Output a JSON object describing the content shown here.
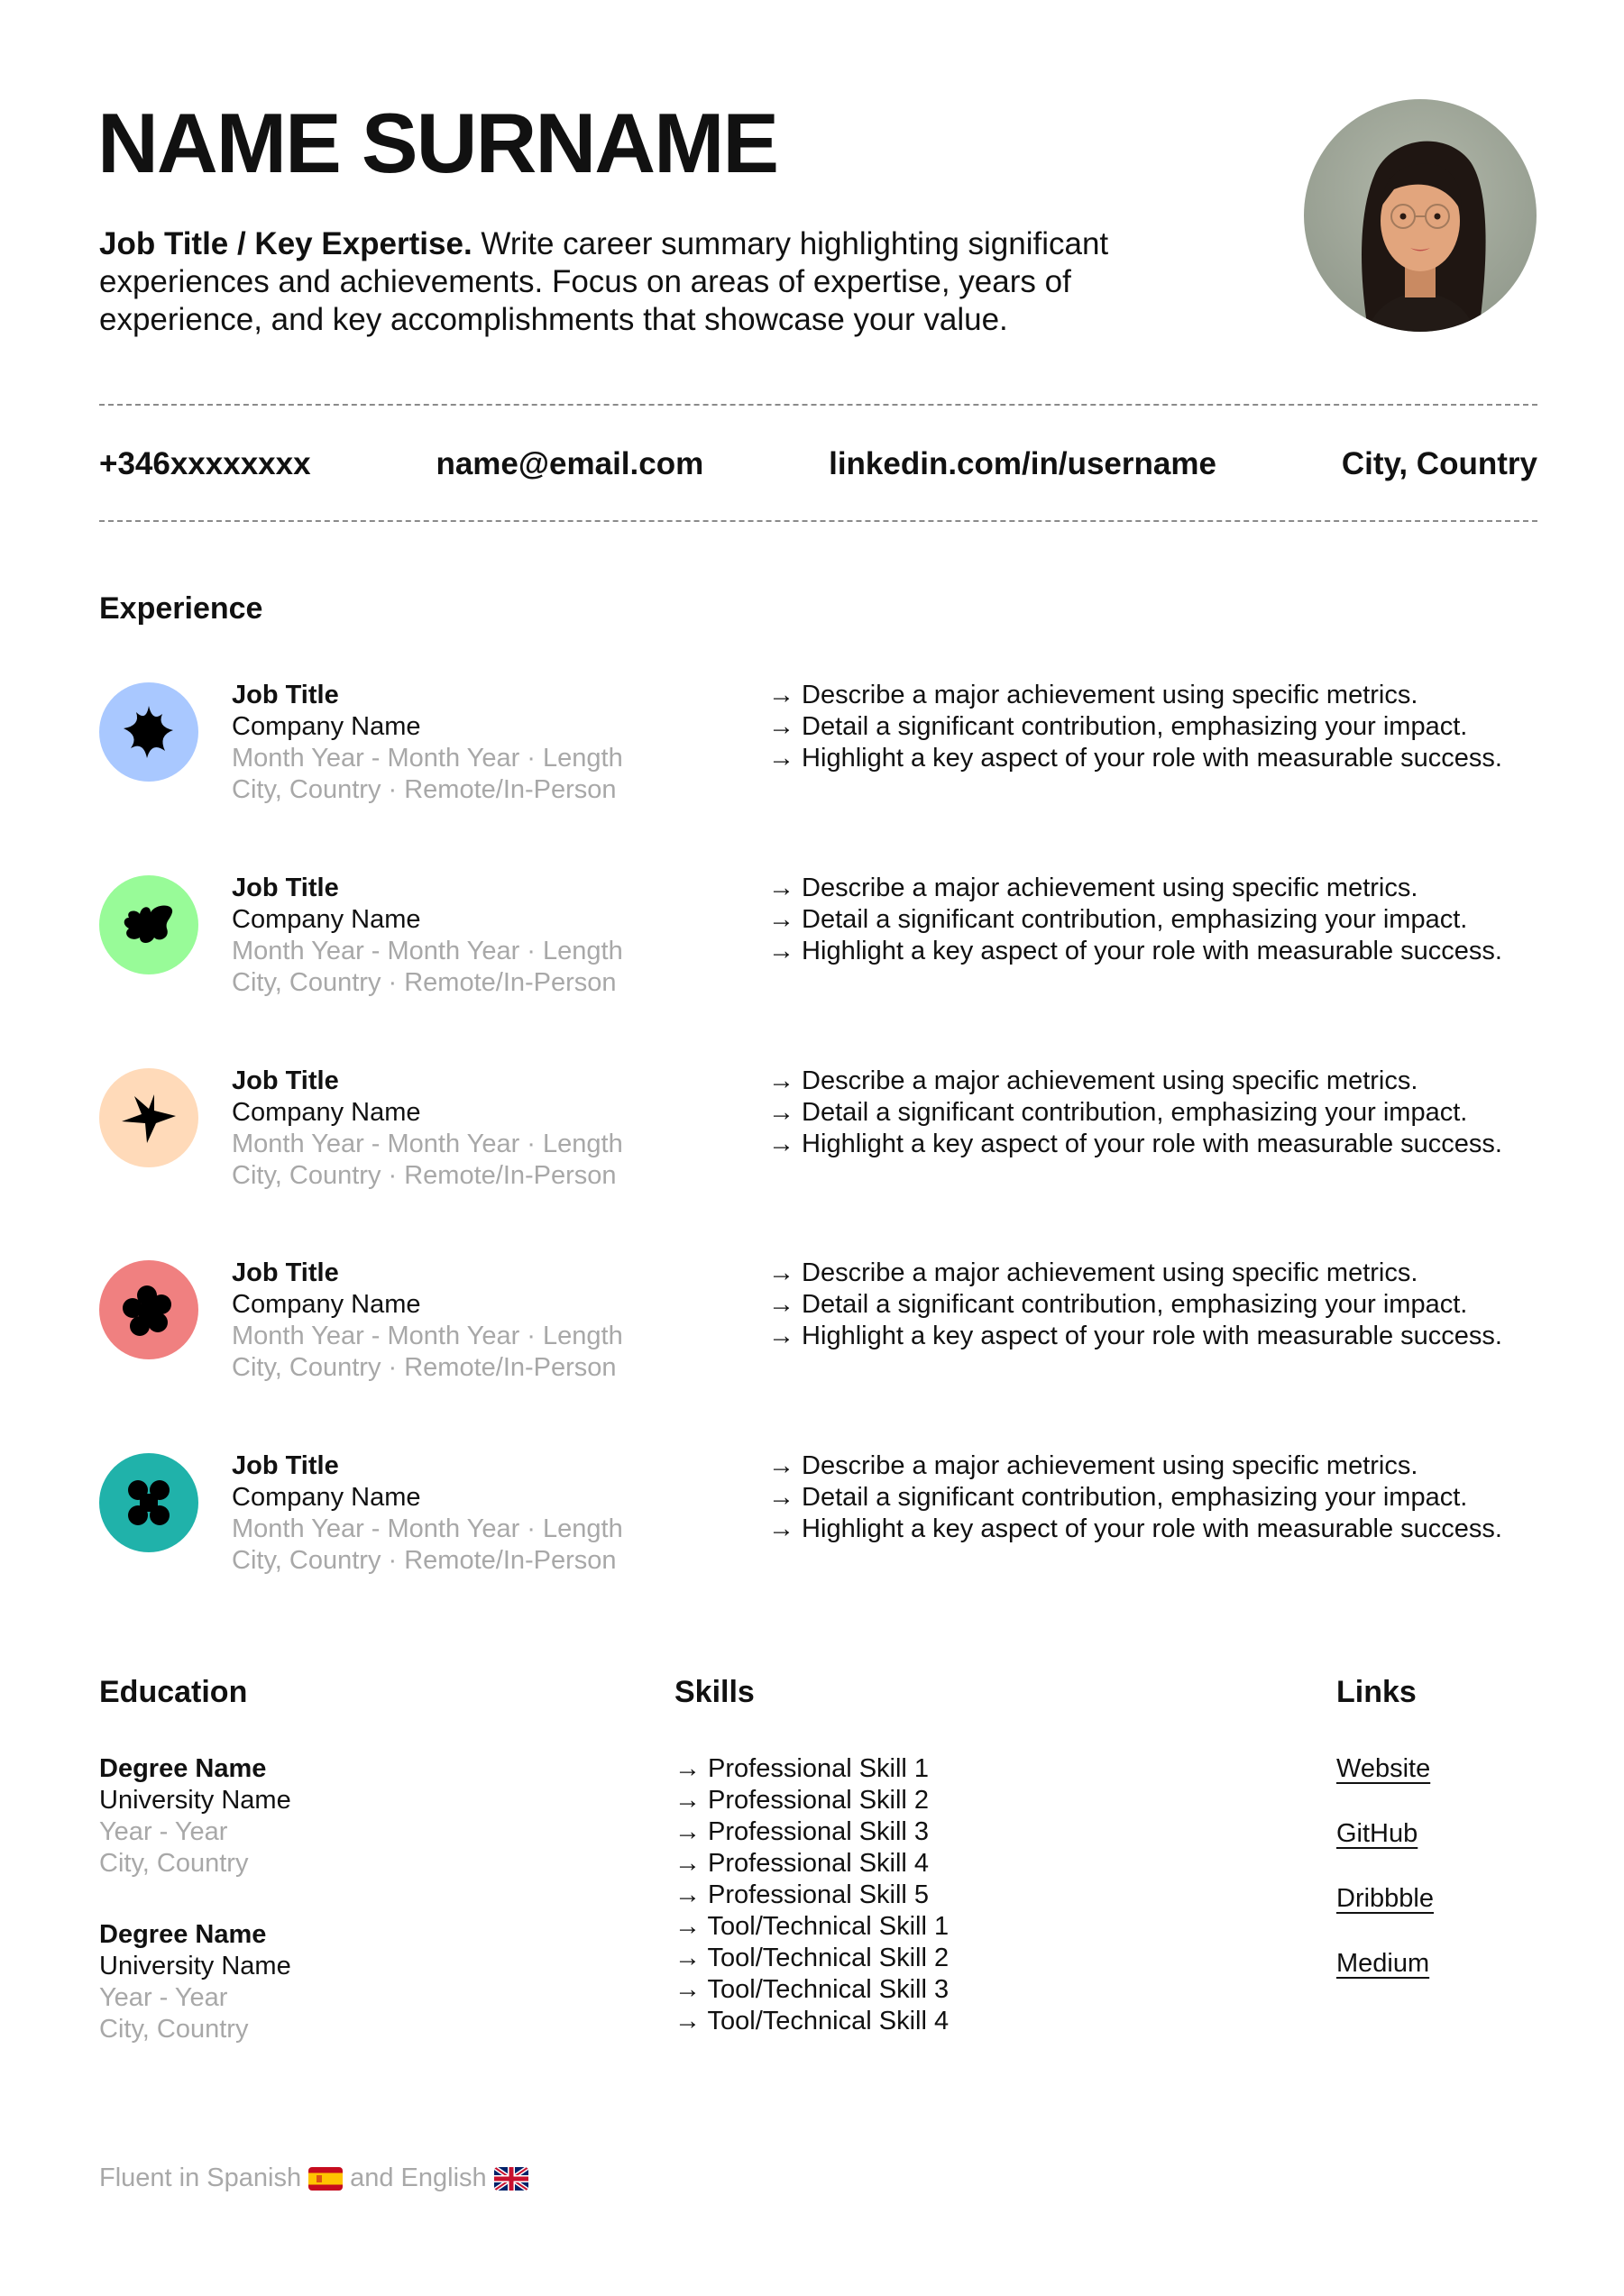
{
  "header": {
    "name": "NAME SURNAME",
    "summary_lead": "Job Title / Key Expertise.",
    "summary_text": " Write career summary highlighting significant experiences and achievements. Focus on areas of expertise, years of experience, and key accomplishments that showcase your value.",
    "avatar": "portrait-photo"
  },
  "contact": {
    "phone": "+346xxxxxxxx",
    "email": "name@email.com",
    "linkedin": "linkedin.com/in/username",
    "location": "City, Country"
  },
  "experience": {
    "heading": "Experience",
    "items": [
      {
        "title": "Job Title",
        "company": "Company Name",
        "dates": "Month Year - Month Year · Length",
        "location": "City, Country · Remote/In-Person",
        "icon": "sparkle-star-icon",
        "color": "#a9c8ff",
        "bullets": [
          "→ Describe a major achievement using specific metrics.",
          "→ Detail a significant contribution, emphasizing your impact.",
          "→ Highlight a key aspect of your role with measurable success."
        ]
      },
      {
        "title": "Job Title",
        "company": "Company Name",
        "dates": "Month Year - Month Year · Length",
        "location": "City, Country · Remote/In-Person",
        "icon": "blob-butterfly-icon",
        "color": "#98fb98",
        "bullets": [
          "→ Describe a major achievement using specific metrics.",
          "→ Detail a significant contribution, emphasizing your impact.",
          "→ Highlight a key aspect of your role with measurable success."
        ]
      },
      {
        "title": "Job Title",
        "company": "Company Name",
        "dates": "Month Year - Month Year · Length",
        "location": "City, Country · Remote/In-Person",
        "icon": "star-icon",
        "color": "#ffdab9",
        "bullets": [
          "→ Describe a major achievement using specific metrics.",
          "→ Detail a significant contribution, emphasizing your impact.",
          "→ Highlight a key aspect of your role with measurable success."
        ]
      },
      {
        "title": "Job Title",
        "company": "Company Name",
        "dates": "Month Year - Month Year · Length",
        "location": "City, Country · Remote/In-Person",
        "icon": "flower-icon",
        "color": "#f08080",
        "bullets": [
          "→ Describe a major achievement using specific metrics.",
          "→ Detail a significant contribution, emphasizing your impact.",
          "→ Highlight a key aspect of your role with measurable success."
        ]
      },
      {
        "title": "Job Title",
        "company": "Company Name",
        "dates": "Month Year - Month Year · Length",
        "location": "City, Country · Remote/In-Person",
        "icon": "clover-icon",
        "color": "#20b2aa",
        "bullets": [
          "→ Describe a major achievement using specific metrics.",
          "→ Detail a significant contribution, emphasizing your impact.",
          "→ Highlight a key aspect of your role with measurable success."
        ]
      }
    ]
  },
  "education": {
    "heading": "Education",
    "items": [
      {
        "degree": "Degree Name",
        "university": "University Name",
        "years": "Year - Year",
        "location": "City, Country"
      },
      {
        "degree": "Degree Name",
        "university": "University Name",
        "years": "Year - Year",
        "location": "City, Country"
      }
    ]
  },
  "skills": {
    "heading": "Skills",
    "items": [
      "→ Professional Skill 1",
      "→ Professional Skill 2",
      "→ Professional Skill 3",
      "→ Professional Skill 4",
      "→ Professional Skill 5",
      "→ Tool/Technical Skill 1",
      "→ Tool/Technical Skill 2",
      "→ Tool/Technical Skill 3",
      "→ Tool/Technical Skill 4"
    ]
  },
  "links": {
    "heading": "Links",
    "items": [
      "Website",
      "GitHub",
      "Dribbble",
      "Medium"
    ]
  },
  "footer": {
    "text_1": "Fluent in Spanish",
    "flag_1": "spain-flag",
    "text_2": "and English",
    "flag_2": "uk-flag"
  }
}
